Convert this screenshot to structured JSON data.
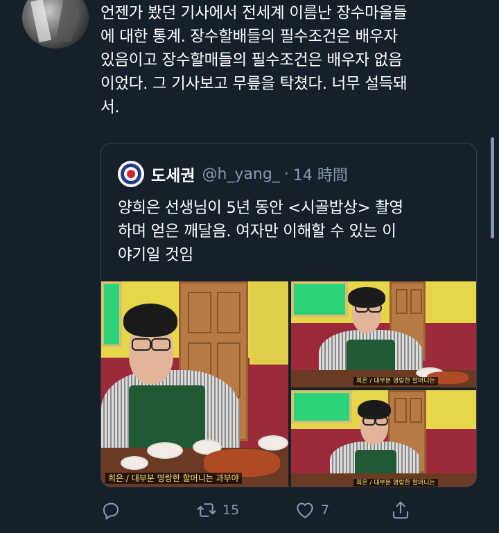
{
  "tweet": {
    "lines": [
      "언젠가 봤던 기사에서 전세계 이름난 장수마을들",
      "에 대한 통계. 장수할배들의 필수조건은 배우자",
      "있음이고 장수할매들의 필수조건은 배우자 없음",
      "이었다. 그 기사보고 무릎을 탁쳤다. 너무 설득돼",
      "서."
    ]
  },
  "quote": {
    "name": "도세권",
    "handle": "@h_yang_",
    "separator": "·",
    "time": "14 時間",
    "lines": [
      "양희은 선생님이 5년 동안 <시골밥상> 촬영",
      "하며 얻은 깨달음. 여자만 이해할 수 있는 이",
      "야기일 것임"
    ],
    "media": {
      "main_subtitle": "희은 / 대부분 명랑한 할머니는 과부야",
      "top_right_subtitle": "희은 / 대부분 명랑한 할머니는",
      "bottom_right_subtitle": "희은 / 대부분 명랑한 할머니는"
    }
  },
  "actions": {
    "reply_icon": "reply-icon",
    "retweet_icon": "retweet-icon",
    "retweet_count": "15",
    "like_icon": "heart-icon",
    "like_count": "7",
    "share_icon": "share-icon"
  },
  "colors": {
    "background": "#15202b",
    "text": "#ffffff",
    "secondary": "#8899a6",
    "border": "#38444d"
  }
}
